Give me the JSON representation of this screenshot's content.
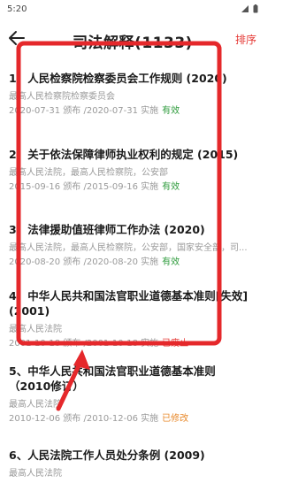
{
  "status_bar": {
    "time": "5:20"
  },
  "header": {
    "title": "司法解释(1133)",
    "sort_label": "排序"
  },
  "items": [
    {
      "title": "1、人民检察院检察委员会工作规则 (2020)",
      "org": "最高人民检察院检察委员会",
      "dates": "2020-07-31 颁布 /2020-07-31 实施",
      "status": "有效",
      "status_color": "#2e9b3c"
    },
    {
      "title": "2、关于依法保障律师执业权利的规定 (2015)",
      "org": "最高人民法院，最高人民检察院，公安部",
      "dates": "2015-09-16 颁布 /2015-09-16 实施",
      "status": "有效",
      "status_color": "#2e9b3c"
    },
    {
      "title": "3、法律援助值班律师工作办法 (2020)",
      "org": "最高人民法院，最高人民检察院，公安部，国家安全部，司...",
      "dates": "2020-08-20 颁布 /2020-08-20 实施",
      "status": "有效",
      "status_color": "#2e9b3c"
    },
    {
      "title": "4、中华人民共和国法官职业道德基本准则[失效](2001)",
      "org": "最高人民法院",
      "dates": "2001-10-18 颁布 /2001-10-18 实施",
      "status": "已废止",
      "status_color": "#e53935"
    },
    {
      "title": "5、中华人民共和国法官职业道德基本准则（2010修订）",
      "org": "最高人民法院",
      "dates": "2010-12-06 颁布 /2010-12-06 实施",
      "status": "已修改",
      "status_color": "#e8892b"
    },
    {
      "title": "6、人民法院工作人员处分条例 (2009)",
      "org": "最高人民法院",
      "dates": "",
      "status": "",
      "status_color": ""
    }
  ]
}
